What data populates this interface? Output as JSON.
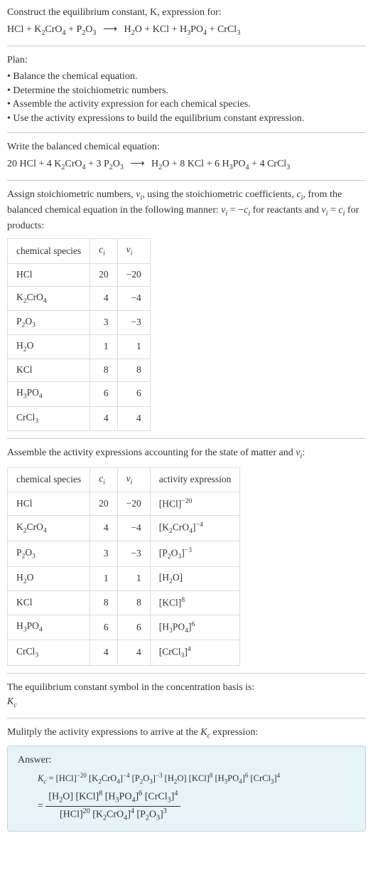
{
  "title": "Construct the equilibrium constant, K, expression for:",
  "equation_unbalanced_html": "HCl + K<span class='sub'>2</span>CrO<span class='sub'>4</span> + P<span class='sub'>2</span>O<span class='sub'>3</span> <span class='arrow'>⟶</span> H<span class='sub'>2</span>O + KCl + H<span class='sub'>3</span>PO<span class='sub'>4</span> + CrCl<span class='sub'>3</span>",
  "plan_label": "Plan:",
  "plan_items": [
    "Balance the chemical equation.",
    "Determine the stoichiometric numbers.",
    "Assemble the activity expression for each chemical species.",
    "Use the activity expressions to build the equilibrium constant expression."
  ],
  "balanced_label": "Write the balanced chemical equation:",
  "equation_balanced_html": "20 HCl + 4 K<span class='sub'>2</span>CrO<span class='sub'>4</span> + 3 P<span class='sub'>2</span>O<span class='sub'>3</span> <span class='arrow'>⟶</span> H<span class='sub'>2</span>O + 8 KCl + 6 H<span class='sub'>3</span>PO<span class='sub'>4</span> + 4 CrCl<span class='sub'>3</span>",
  "stoich_text_html": "Assign stoichiometric numbers, <span class='ital'>ν<span class='sub'>i</span></span>, using the stoichiometric coefficients, <span class='ital'>c<span class='sub'>i</span></span>, from the balanced chemical equation in the following manner: <span class='ital'>ν<span class='sub'>i</span></span> = −<span class='ital'>c<span class='sub'>i</span></span> for reactants and <span class='ital'>ν<span class='sub'>i</span></span> = <span class='ital'>c<span class='sub'>i</span></span> for products:",
  "table1": {
    "headers": [
      "chemical species",
      "c_i",
      "ν_i"
    ],
    "header_html": [
      "chemical species",
      "<span class='ital'>c<span class='sub'>i</span></span>",
      "<span class='ital'>ν<span class='sub'>i</span></span>"
    ],
    "rows": [
      {
        "species_html": "HCl",
        "c": "20",
        "v": "−20"
      },
      {
        "species_html": "K<span class='sub'>2</span>CrO<span class='sub'>4</span>",
        "c": "4",
        "v": "−4"
      },
      {
        "species_html": "P<span class='sub'>2</span>O<span class='sub'>3</span>",
        "c": "3",
        "v": "−3"
      },
      {
        "species_html": "H<span class='sub'>2</span>O",
        "c": "1",
        "v": "1"
      },
      {
        "species_html": "KCl",
        "c": "8",
        "v": "8"
      },
      {
        "species_html": "H<span class='sub'>3</span>PO<span class='sub'>4</span>",
        "c": "6",
        "v": "6"
      },
      {
        "species_html": "CrCl<span class='sub'>3</span>",
        "c": "4",
        "v": "4"
      }
    ]
  },
  "activity_text_html": "Assemble the activity expressions accounting for the state of matter and <span class='ital'>ν<span class='sub'>i</span></span>:",
  "table2": {
    "headers": [
      "chemical species",
      "c_i",
      "ν_i",
      "activity expression"
    ],
    "header_html": [
      "chemical species",
      "<span class='ital'>c<span class='sub'>i</span></span>",
      "<span class='ital'>ν<span class='sub'>i</span></span>",
      "activity expression"
    ],
    "rows": [
      {
        "species_html": "HCl",
        "c": "20",
        "v": "−20",
        "act_html": "[HCl]<span class='sup'>−20</span>"
      },
      {
        "species_html": "K<span class='sub'>2</span>CrO<span class='sub'>4</span>",
        "c": "4",
        "v": "−4",
        "act_html": "[K<span class='sub'>2</span>CrO<span class='sub'>4</span>]<span class='sup'>−4</span>"
      },
      {
        "species_html": "P<span class='sub'>2</span>O<span class='sub'>3</span>",
        "c": "3",
        "v": "−3",
        "act_html": "[P<span class='sub'>2</span>O<span class='sub'>3</span>]<span class='sup'>−3</span>"
      },
      {
        "species_html": "H<span class='sub'>2</span>O",
        "c": "1",
        "v": "1",
        "act_html": "[H<span class='sub'>2</span>O]"
      },
      {
        "species_html": "KCl",
        "c": "8",
        "v": "8",
        "act_html": "[KCl]<span class='sup'>8</span>"
      },
      {
        "species_html": "H<span class='sub'>3</span>PO<span class='sub'>4</span>",
        "c": "6",
        "v": "6",
        "act_html": "[H<span class='sub'>3</span>PO<span class='sub'>4</span>]<span class='sup'>6</span>"
      },
      {
        "species_html": "CrCl<span class='sub'>3</span>",
        "c": "4",
        "v": "4",
        "act_html": "[CrCl<span class='sub'>3</span>]<span class='sup'>4</span>"
      }
    ]
  },
  "symbol_text": "The equilibrium constant symbol in the concentration basis is:",
  "symbol_html": "<span class='ital'>K<span class='sub'>c</span></span>",
  "multiply_text_html": "Mulitply the activity expressions to arrive at the <span class='ital'>K<span class='sub'>c</span></span> expression:",
  "answer_label": "Answer:",
  "answer_line1_html": "<span class='ital'>K<span class='sub'>c</span></span> = [HCl]<span class='sup'>−20</span> [K<span class='sub'>2</span>CrO<span class='sub'>4</span>]<span class='sup'>−4</span> [P<span class='sub'>2</span>O<span class='sub'>3</span>]<span class='sup'>−3</span> [H<span class='sub'>2</span>O] [KCl]<span class='sup'>8</span> [H<span class='sub'>3</span>PO<span class='sub'>4</span>]<span class='sup'>6</span> [CrCl<span class='sub'>3</span>]<span class='sup'>4</span>",
  "answer_frac_num_html": "[H<span class='sub'>2</span>O] [KCl]<span class='sup'>8</span> [H<span class='sub'>3</span>PO<span class='sub'>4</span>]<span class='sup'>6</span> [CrCl<span class='sub'>3</span>]<span class='sup'>4</span>",
  "answer_frac_den_html": "[HCl]<span class='sup'>20</span> [K<span class='sub'>2</span>CrO<span class='sub'>4</span>]<span class='sup'>4</span> [P<span class='sub'>2</span>O<span class='sub'>3</span>]<span class='sup'>3</span>",
  "chart_data": {
    "type": "table",
    "title": "Stoichiometric numbers and activity expressions",
    "species": [
      "HCl",
      "K2CrO4",
      "P2O3",
      "H2O",
      "KCl",
      "H3PO4",
      "CrCl3"
    ],
    "c_i": [
      20,
      4,
      3,
      1,
      8,
      6,
      4
    ],
    "nu_i": [
      -20,
      -4,
      -3,
      1,
      8,
      6,
      4
    ],
    "activity": [
      "[HCl]^-20",
      "[K2CrO4]^-4",
      "[P2O3]^-3",
      "[H2O]",
      "[KCl]^8",
      "[H3PO4]^6",
      "[CrCl3]^4"
    ]
  }
}
